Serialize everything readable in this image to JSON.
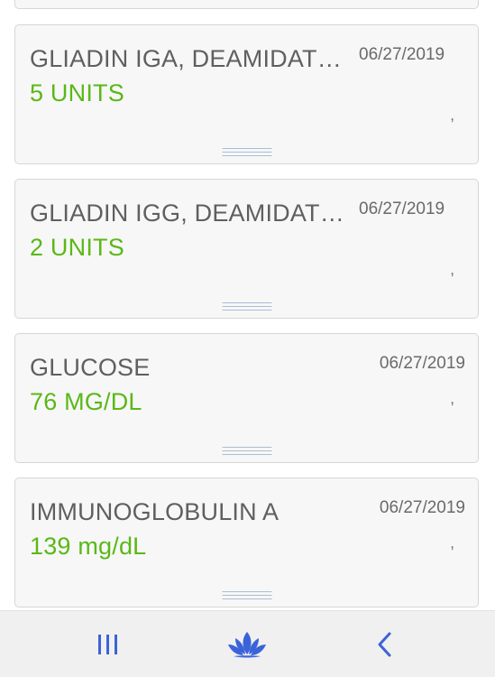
{
  "results": [
    {
      "name": "",
      "value": "",
      "date": "",
      "note": ""
    },
    {
      "name": "GLIADIN IGA, DEAMIDATED PEPTIDE",
      "value": "5 UNITS",
      "date": "06/27/2019",
      "note": ","
    },
    {
      "name": "GLIADIN IGG, DEAMIDATED PEPTIDE",
      "value": "2 UNITS",
      "date": "06/27/2019",
      "note": ","
    },
    {
      "name": "GLUCOSE",
      "value": "76 MG/DL",
      "date": "06/27/2019",
      "note": ","
    },
    {
      "name": "IMMUNOGLOBULIN A",
      "value": "139 mg/dL",
      "date": "06/27/2019",
      "note": ","
    }
  ],
  "colors": {
    "value_green": "#5ab817",
    "nav_icon": "#3b63d9"
  },
  "navbar": {
    "recent_icon": "recent-apps-icon",
    "home_icon": "lotus-home-icon",
    "back_icon": "back-icon"
  }
}
